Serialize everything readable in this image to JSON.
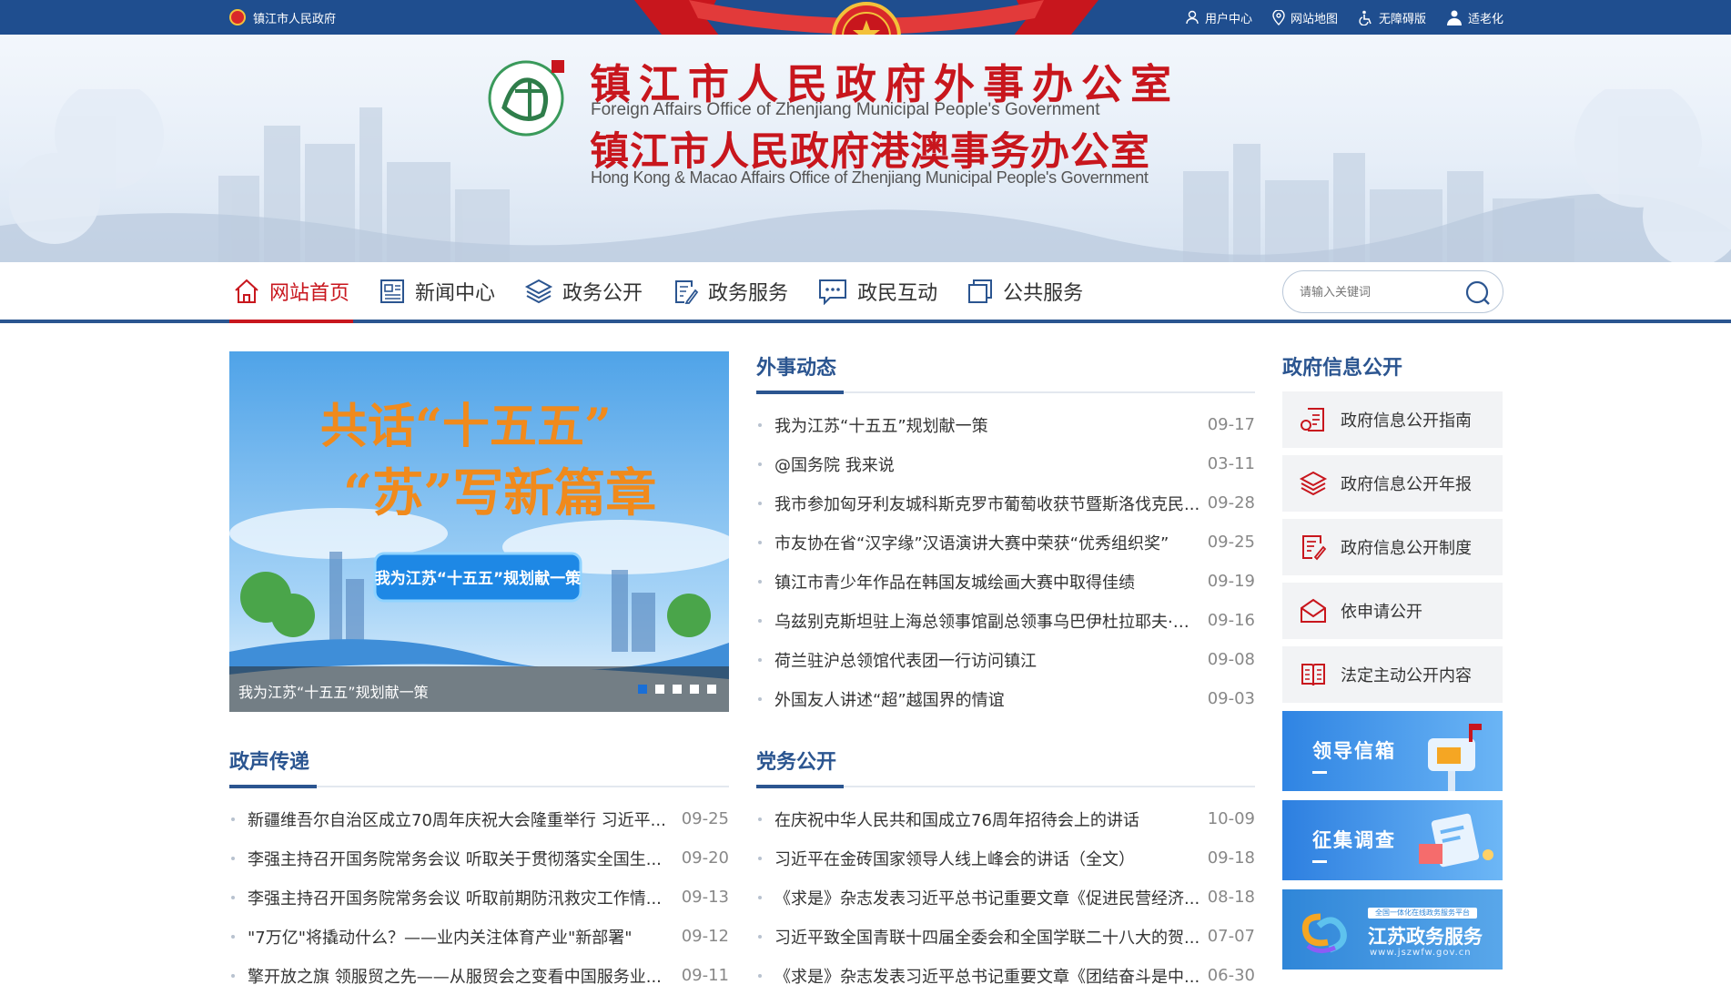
{
  "topbar": {
    "site_name": "镇江市人民政府",
    "links": [
      {
        "label": "用户中心",
        "icon": "user-icon"
      },
      {
        "label": "网站地图",
        "icon": "map-pin-icon"
      },
      {
        "label": "无障碍版",
        "icon": "wheelchair-icon"
      },
      {
        "label": "适老化",
        "icon": "elderly-icon"
      }
    ]
  },
  "header": {
    "title_cn_1": "镇江市人民政府外事办公室",
    "title_en_1": "Foreign Affairs Office of Zhenjiang Municipal People's Government",
    "title_cn_2": "镇江市人民政府港澳事务办公室",
    "title_en_2": "Hong Kong & Macao Affairs Office of Zhenjiang Municipal People's Government"
  },
  "nav": {
    "items": [
      {
        "label": "网站首页",
        "icon": "home-icon",
        "active": true
      },
      {
        "label": "新闻中心",
        "icon": "newspaper-icon"
      },
      {
        "label": "政务公开",
        "icon": "layers-icon"
      },
      {
        "label": "政务服务",
        "icon": "document-edit-icon"
      },
      {
        "label": "政民互动",
        "icon": "chat-icon"
      },
      {
        "label": "公共服务",
        "icon": "copy-icon"
      }
    ],
    "search_placeholder": "请输入关键词"
  },
  "carousel": {
    "banner_line1": "共话“十五五”",
    "banner_line2": "“苏”写新篇章",
    "banner_button": "我为江苏“十五五”规划献一策",
    "caption": "我为江苏“十五五”规划献一策",
    "dot_count": 5,
    "active_dot": 1,
    "colors": {
      "sky": "#4fa3e8",
      "title_text": "#f08a1c",
      "button": "#1e88e5"
    }
  },
  "sections": {
    "waishi": {
      "title": "外事动态",
      "items": [
        {
          "title": "我为江苏“十五五”规划献一策",
          "date": "09-17"
        },
        {
          "title": "@国务院 我来说",
          "date": "03-11"
        },
        {
          "title": "我市参加匈牙利友城科斯克罗市葡萄收获节暨斯洛伐克民...",
          "date": "09-28"
        },
        {
          "title": "市友协在省“汉字缘”汉语演讲大赛中荣获“优秀组织奖”",
          "date": "09-25"
        },
        {
          "title": "镇江市青少年作品在韩国友城绘画大赛中取得佳绩",
          "date": "09-19"
        },
        {
          "title": "乌兹别克斯坦驻上海总领事馆副总领事乌巴伊杜拉耶夫·库...",
          "date": "09-16"
        },
        {
          "title": "荷兰驻沪总领馆代表团一行访问镇江",
          "date": "09-08"
        },
        {
          "title": "外国友人讲述“超”越国界的情谊",
          "date": "09-03"
        }
      ]
    },
    "zhengsheng": {
      "title": "政声传递",
      "items": [
        {
          "title": "新疆维吾尔自治区成立70周年庆祝大会隆重举行 习近平...",
          "date": "09-25"
        },
        {
          "title": "李强主持召开国务院常务会议 听取关于贯彻落实全国生...",
          "date": "09-20"
        },
        {
          "title": "李强主持召开国务院常务会议 听取前期防汛救灾工作情...",
          "date": "09-13"
        },
        {
          "title": "\"7万亿\"将撬动什么？——业内关注体育产业\"新部署\"",
          "date": "09-12"
        },
        {
          "title": "擎开放之旗 领服贸之先——从服贸会之变看中国服务业...",
          "date": "09-11"
        }
      ]
    },
    "dangwu": {
      "title": "党务公开",
      "items": [
        {
          "title": "在庆祝中华人民共和国成立76周年招待会上的讲话",
          "date": "10-09"
        },
        {
          "title": "习近平在金砖国家领导人线上峰会的讲话（全文）",
          "date": "09-18"
        },
        {
          "title": "《求是》杂志发表习近平总书记重要文章《促进民营经济...",
          "date": "08-18"
        },
        {
          "title": "习近平致全国青联十四届全委会和全国学联二十八大的贺...",
          "date": "07-07"
        },
        {
          "title": "《求是》杂志发表习近平总书记重要文章《团结奋斗是中...",
          "date": "06-30"
        }
      ]
    }
  },
  "sidebar": {
    "title": "政府信息公开",
    "items": [
      {
        "label": "政府信息公开指南",
        "icon": "guide-doc-icon"
      },
      {
        "label": "政府信息公开年报",
        "icon": "layers-icon"
      },
      {
        "label": "政府信息公开制度",
        "icon": "document-list-icon"
      },
      {
        "label": "依申请公开",
        "icon": "envelope-icon"
      },
      {
        "label": "法定主动公开内容",
        "icon": "book-icon"
      }
    ],
    "promos": [
      {
        "label": "领导信箱",
        "icon": "mailbox-icon",
        "color": "#3b8fe6"
      },
      {
        "label": "征集调查",
        "icon": "survey-icon",
        "color": "#3c8de8"
      },
      {
        "label": "江苏政务服务",
        "sublabel": "全国一体化在线政务服务平台",
        "url_text": "www.jszwfw.gov.cn",
        "icon": "jiangsu-service-logo-icon",
        "color": "#2f86d8"
      }
    ]
  },
  "colors": {
    "primary": "#2b5590",
    "accent_red": "#c8161d",
    "topbar": "#1f4e8f"
  }
}
